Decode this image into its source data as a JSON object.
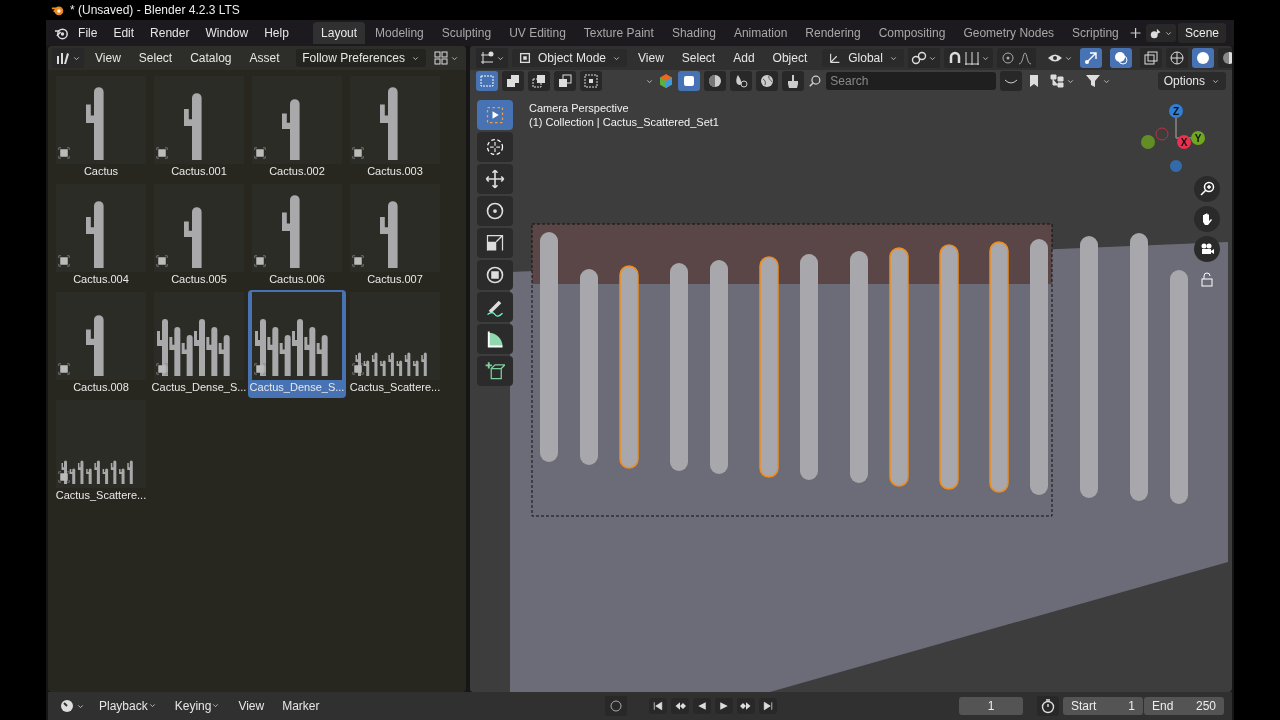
{
  "window": {
    "title": "* (Unsaved) - Blender 4.2.3 LTS"
  },
  "menu": [
    "File",
    "Edit",
    "Render",
    "Window",
    "Help"
  ],
  "workspaces": [
    {
      "label": "Layout",
      "selected": true
    },
    {
      "label": "Modeling",
      "selected": false
    },
    {
      "label": "Sculpting",
      "selected": false
    },
    {
      "label": "UV Editing",
      "selected": false
    },
    {
      "label": "Texture Paint",
      "selected": false
    },
    {
      "label": "Shading",
      "selected": false
    },
    {
      "label": "Animation",
      "selected": false
    },
    {
      "label": "Rendering",
      "selected": false
    },
    {
      "label": "Compositing",
      "selected": false
    },
    {
      "label": "Geometry Nodes",
      "selected": false
    },
    {
      "label": "Scripting",
      "selected": false
    }
  ],
  "scene": "Scene",
  "asset_browser": {
    "menu": [
      "View",
      "Select",
      "Catalog",
      "Asset"
    ],
    "import_method": "Follow Preferences",
    "assets": [
      {
        "name": "Cactus",
        "selected": false
      },
      {
        "name": "Cactus.001",
        "selected": false
      },
      {
        "name": "Cactus.002",
        "selected": false
      },
      {
        "name": "Cactus.003",
        "selected": false
      },
      {
        "name": "Cactus.004",
        "selected": false
      },
      {
        "name": "Cactus.005",
        "selected": false
      },
      {
        "name": "Cactus.006",
        "selected": false
      },
      {
        "name": "Cactus.007",
        "selected": false
      },
      {
        "name": "Cactus.008",
        "selected": false
      },
      {
        "name": "Cactus_Dense_S...",
        "selected": false
      },
      {
        "name": "Cactus_Dense_S...",
        "selected": true
      },
      {
        "name": "Cactus_Scattere...",
        "selected": false
      },
      {
        "name": "Cactus_Scattere...",
        "selected": false
      }
    ]
  },
  "viewport": {
    "mode": "Object Mode",
    "menu": [
      "View",
      "Select",
      "Add",
      "Object"
    ],
    "orientation": "Global",
    "search": {
      "placeholder": "Search"
    },
    "options": "Options",
    "overlay_lines": [
      "Camera Perspective",
      "(1) Collection | Cactus_Scattered_Set1"
    ],
    "tools": [
      {
        "kind": "select",
        "selected": true
      },
      {
        "kind": "cursor",
        "selected": false
      },
      {
        "kind": "move",
        "selected": false
      },
      {
        "kind": "rotate",
        "selected": false
      },
      {
        "kind": "scale",
        "selected": false
      },
      {
        "kind": "transform",
        "selected": false
      },
      {
        "kind": "annotate",
        "selected": false
      },
      {
        "kind": "measure",
        "selected": false
      },
      {
        "kind": "add",
        "selected": false
      }
    ],
    "axes": [
      {
        "label": "Z",
        "color": "#2f7fd8"
      },
      {
        "label": "X",
        "color": "#e8304f"
      },
      {
        "label": "Y",
        "color": "#6fa81e"
      }
    ]
  },
  "timeline": {
    "menu": [
      "Playback",
      "Keying",
      "View",
      "Marker"
    ],
    "current_frame": "1",
    "start_label": "Start",
    "start": "1",
    "end_label": "End",
    "end": "250"
  }
}
